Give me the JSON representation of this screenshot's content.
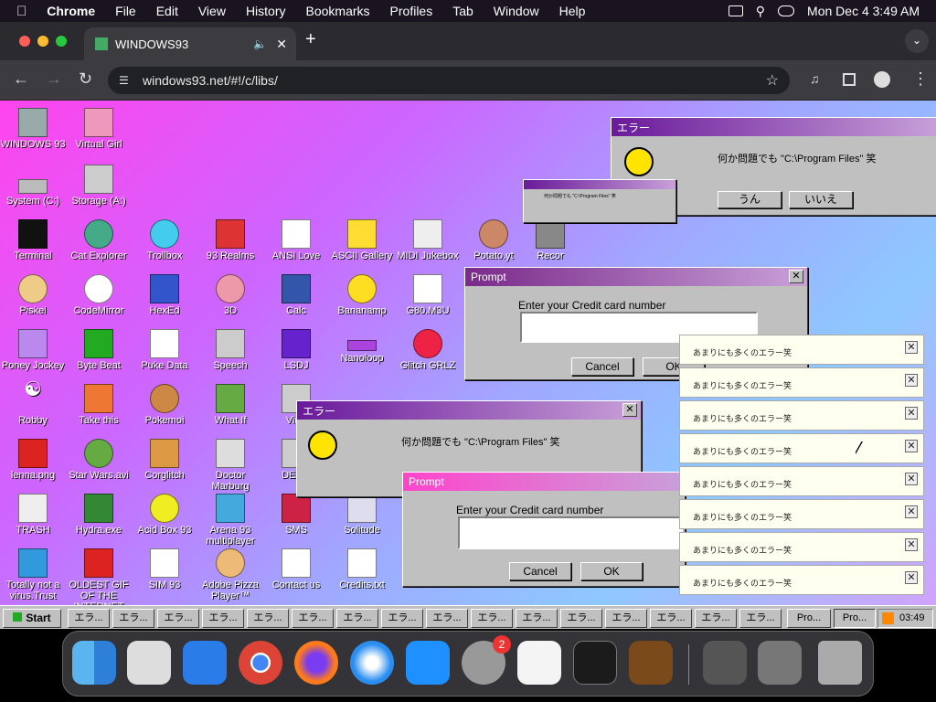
{
  "menubar": {
    "app": "Chrome",
    "items": [
      "File",
      "Edit",
      "View",
      "History",
      "Bookmarks",
      "Profiles",
      "Tab",
      "Window",
      "Help"
    ],
    "clock": "Mon Dec 4  3:49 AM"
  },
  "browser": {
    "tab_title": "WINDOWS93",
    "url": "windows93.net/#!/c/libs/"
  },
  "desktop": {
    "icons": [
      {
        "label": "WINDOWS 93"
      },
      {
        "label": "Virtual Girl"
      },
      {
        "label": "System (C:)"
      },
      {
        "label": "Storage (A:)"
      },
      {
        "label": "Terminal"
      },
      {
        "label": "Cat Explorer"
      },
      {
        "label": "Trollbox"
      },
      {
        "label": "93 Realms"
      },
      {
        "label": "ANSI Love"
      },
      {
        "label": "ASCII Gallery"
      },
      {
        "label": "MIDI Jukebox"
      },
      {
        "label": "Potato.yt"
      },
      {
        "label": "Recor"
      },
      {
        "label": "Piskel"
      },
      {
        "label": "CodeMirror"
      },
      {
        "label": "HexEd"
      },
      {
        "label": "3D"
      },
      {
        "label": "Calc"
      },
      {
        "label": "Bananamp"
      },
      {
        "label": "G80.M3U"
      },
      {
        "label": "Poney Jockey"
      },
      {
        "label": "Byte Beat"
      },
      {
        "label": "Puke Data"
      },
      {
        "label": "Speech"
      },
      {
        "label": "LSDJ"
      },
      {
        "label": "Nanoloop"
      },
      {
        "label": "Glitch GRLZ"
      },
      {
        "label": "Robby"
      },
      {
        "label": "Take this"
      },
      {
        "label": "Pokemoi"
      },
      {
        "label": "What If"
      },
      {
        "label": "Virtu"
      },
      {
        "label": "lenna.png"
      },
      {
        "label": "Star Wars.avi"
      },
      {
        "label": "Corglitch"
      },
      {
        "label": "Doctor Marburg"
      },
      {
        "label": "DERG"
      },
      {
        "label": "TRASH"
      },
      {
        "label": "Hydra.exe"
      },
      {
        "label": "Acid Box 93"
      },
      {
        "label": "Arena 93 multiplayer"
      },
      {
        "label": "SMS"
      },
      {
        "label": "Solitude"
      },
      {
        "label": "Totally not a virus.Trust"
      },
      {
        "label": "OLDEST GIF OF THE INTERNET"
      },
      {
        "label": "SIM 93"
      },
      {
        "label": "Adobe Pizza Player™"
      },
      {
        "label": "Contact us"
      },
      {
        "label": "Credits.txt"
      }
    ]
  },
  "dialogs": {
    "error_title": "エラー",
    "error_message": "何か問題でも \"C:\\Program Files\" 笑",
    "yes": "うん",
    "no": "いいえ",
    "prompt_title": "Prompt",
    "prompt_label": "Enter your Credit card number",
    "cancel": "Cancel",
    "ok": "OK"
  },
  "notifications": {
    "text": "あまりにも多くのエラー笑",
    "count": 8
  },
  "taskbar": {
    "start": "Start",
    "err_btn": "エラ...",
    "pro_btn": "Pro...",
    "time": "03:49"
  },
  "dock": {
    "badge": "2"
  },
  "colors": {
    "titlebar_error": "#6a1a9a",
    "titlebar_prompt": "#7a2a8a"
  }
}
